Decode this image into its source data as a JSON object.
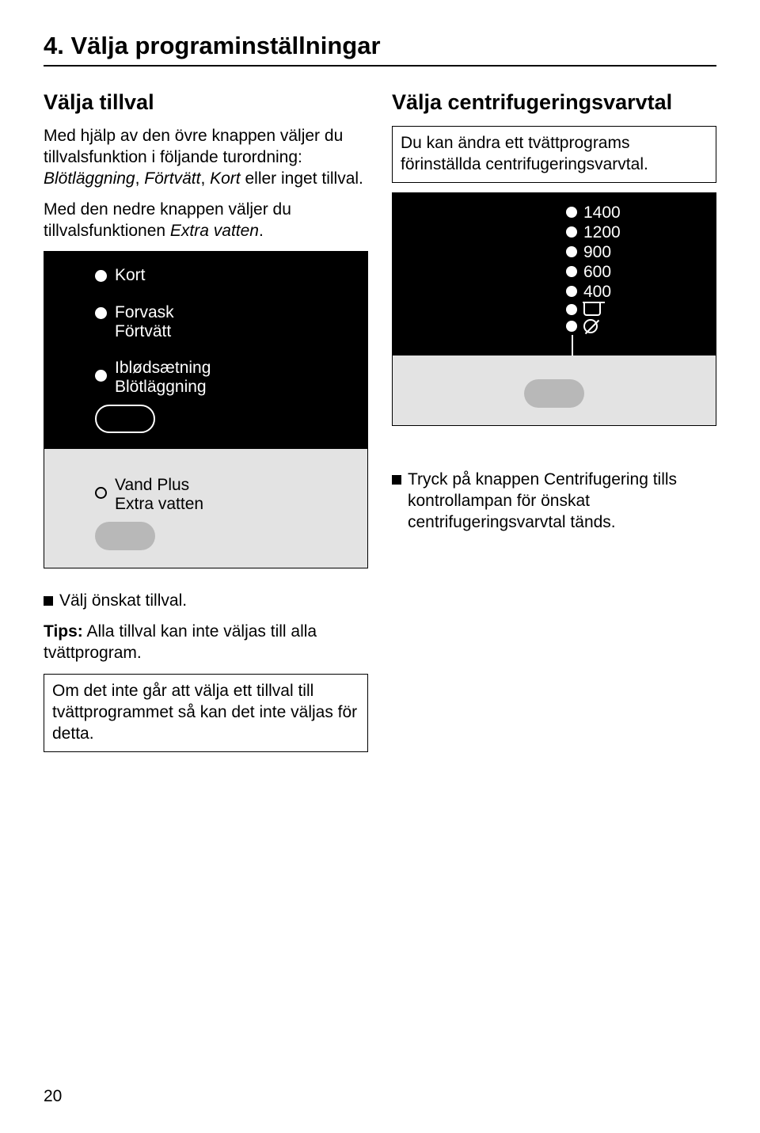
{
  "page_title": "4. Välja programinställningar",
  "page_number": "20",
  "left": {
    "heading": "Välja tillval",
    "para1_a": "Med hjälp av den övre knappen väljer du tillvalsfunktion i följande turordning: ",
    "para1_b": "Blötläggning",
    "para1_c": ", ",
    "para1_d": "Förtvätt",
    "para1_e": ", ",
    "para1_f": "Kort",
    "para1_g": " eller inget tillval.",
    "para2_a": "Med den nedre knappen väljer du tillvalsfunktionen ",
    "para2_b": "Extra vatten",
    "para2_c": ".",
    "panel": {
      "kort": "Kort",
      "forvask": "Forvask",
      "fortvatt": "Förtvätt",
      "iblod": "Iblødsætning",
      "blot": "Blötläggning",
      "vand": "Vand Plus",
      "extra": "Extra vatten"
    },
    "bullet": "Välj önskat tillval.",
    "tips_label": "Tips:",
    "tips_text": " Alla tillval kan inte väljas till alla tvättprogram.",
    "box": "Om det inte går att välja ett tillval till tvättprogrammet så kan det inte väljas för detta."
  },
  "right": {
    "heading": "Välja centrifugeringsvarvtal",
    "box": "Du kan ändra ett tvättprograms förinställda centrifugeringsvarvtal.",
    "speeds": [
      "1400",
      "1200",
      "900",
      "600",
      "400"
    ],
    "bullet": "Tryck på knappen Centrifugering tills kontrollampan för önskat centrifugeringsvarvtal tänds."
  }
}
